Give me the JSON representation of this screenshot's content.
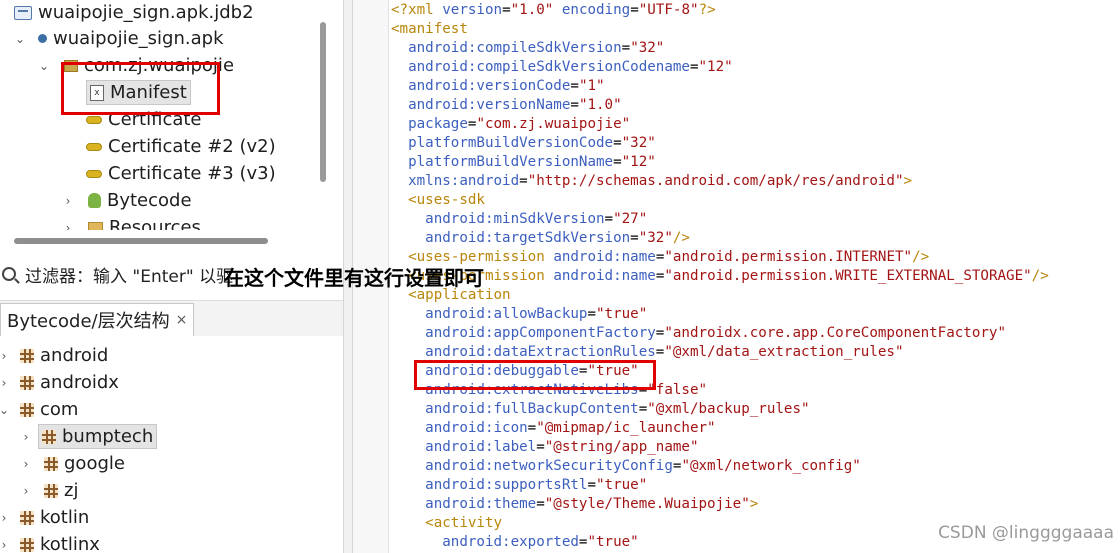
{
  "project_tree": {
    "items": [
      {
        "label": "wuaipojie_sign.apk.jdb2",
        "icon": "project-file-icon"
      },
      {
        "label": "wuaipojie_sign.apk",
        "icon": "apk-dot-icon"
      },
      {
        "label": "com.zj.wuaipojie",
        "icon": "package-icon"
      },
      {
        "label": "Manifest",
        "icon": "xml-file-icon"
      },
      {
        "label": "Certificate",
        "icon": "key-icon"
      },
      {
        "label": "Certificate #2 (v2)",
        "icon": "key-icon"
      },
      {
        "label": "Certificate #3 (v3)",
        "icon": "key-icon"
      },
      {
        "label": "Bytecode",
        "icon": "android-icon"
      },
      {
        "label": "Resources",
        "icon": "folder-icon"
      }
    ]
  },
  "filter": {
    "label": "过滤器：输入 \"Enter\" 以驱"
  },
  "hierarchy_tab": {
    "label": "Bytecode/层次结构",
    "close": "×"
  },
  "hierarchy_tree": {
    "items": [
      {
        "label": "android"
      },
      {
        "label": "androidx"
      },
      {
        "label": "com"
      },
      {
        "label": "bumptech"
      },
      {
        "label": "google"
      },
      {
        "label": "zj"
      },
      {
        "label": "kotlin"
      },
      {
        "label": "kotlinx"
      }
    ]
  },
  "code": {
    "lines": [
      "<?xml version=\"1.0\" encoding=\"UTF-8\"?>",
      "<manifest",
      "  android:compileSdkVersion=\"32\"",
      "  android:compileSdkVersionCodename=\"12\"",
      "  android:versionCode=\"1\"",
      "  android:versionName=\"1.0\"",
      "  package=\"com.zj.wuaipojie\"",
      "  platformBuildVersionCode=\"32\"",
      "  platformBuildVersionName=\"12\"",
      "  xmlns:android=\"http://schemas.android.com/apk/res/android\">",
      "  <uses-sdk",
      "    android:minSdkVersion=\"27\"",
      "    android:targetSdkVersion=\"32\"/>",
      "  <uses-permission android:name=\"android.permission.INTERNET\"/>",
      "  <uses-permission android:name=\"android.permission.WRITE_EXTERNAL_STORAGE\"/>",
      "  <application",
      "    android:allowBackup=\"true\"",
      "    android:appComponentFactory=\"androidx.core.app.CoreComponentFactory\"",
      "    android:dataExtractionRules=\"@xml/data_extraction_rules\"",
      "    android:debuggable=\"true\"",
      "    android:extractNativeLibs=\"false\"",
      "    android:fullBackupContent=\"@xml/backup_rules\"",
      "    android:icon=\"@mipmap/ic_launcher\"",
      "    android:label=\"@string/app_name\"",
      "    android:networkSecurityConfig=\"@xml/network_config\"",
      "    android:supportsRtl=\"true\"",
      "    android:theme=\"@style/Theme.Wuaipojie\">",
      "    <activity",
      "      android:exported=\"true\""
    ]
  },
  "annotation": {
    "note": "在这个文件里有这行设置即可",
    "color": "#e00000"
  },
  "watermark": "CSDN @linggggaaaa"
}
